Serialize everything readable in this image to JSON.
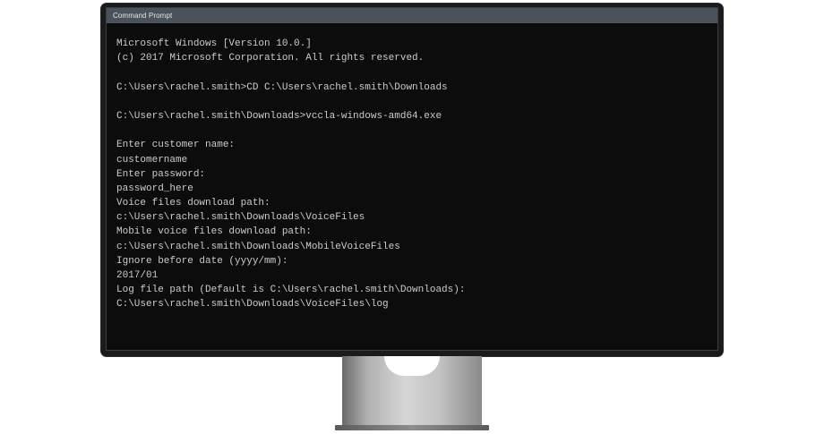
{
  "window": {
    "title": "Command Prompt"
  },
  "console": {
    "lines": [
      "Microsoft Windows [Version 10.0.]",
      "(c) 2017 Microsoft Corporation. All rights reserved.",
      "",
      "C:\\Users\\rachel.smith>CD C:\\Users\\rachel.smith\\Downloads",
      "",
      "C:\\Users\\rachel.smith\\Downloads>vccla-windows-amd64.exe",
      "",
      "Enter customer name:",
      "customername",
      "Enter password:",
      "password_here",
      "Voice files download path:",
      "c:\\Users\\rachel.smith\\Downloads\\VoiceFiles",
      "Mobile voice files download path:",
      "c:\\Users\\rachel.smith\\Downloads\\MobileVoiceFiles",
      "Ignore before date (yyyy/mm):",
      "2017/01",
      "Log file path (Default is C:\\Users\\rachel.smith\\Downloads):",
      "C:\\Users\\rachel.smith\\Downloads\\VoiceFiles\\log"
    ]
  },
  "colors": {
    "console_background": "#0c0c0c",
    "console_text": "#cccccc",
    "titlebar": "#4a535b"
  }
}
